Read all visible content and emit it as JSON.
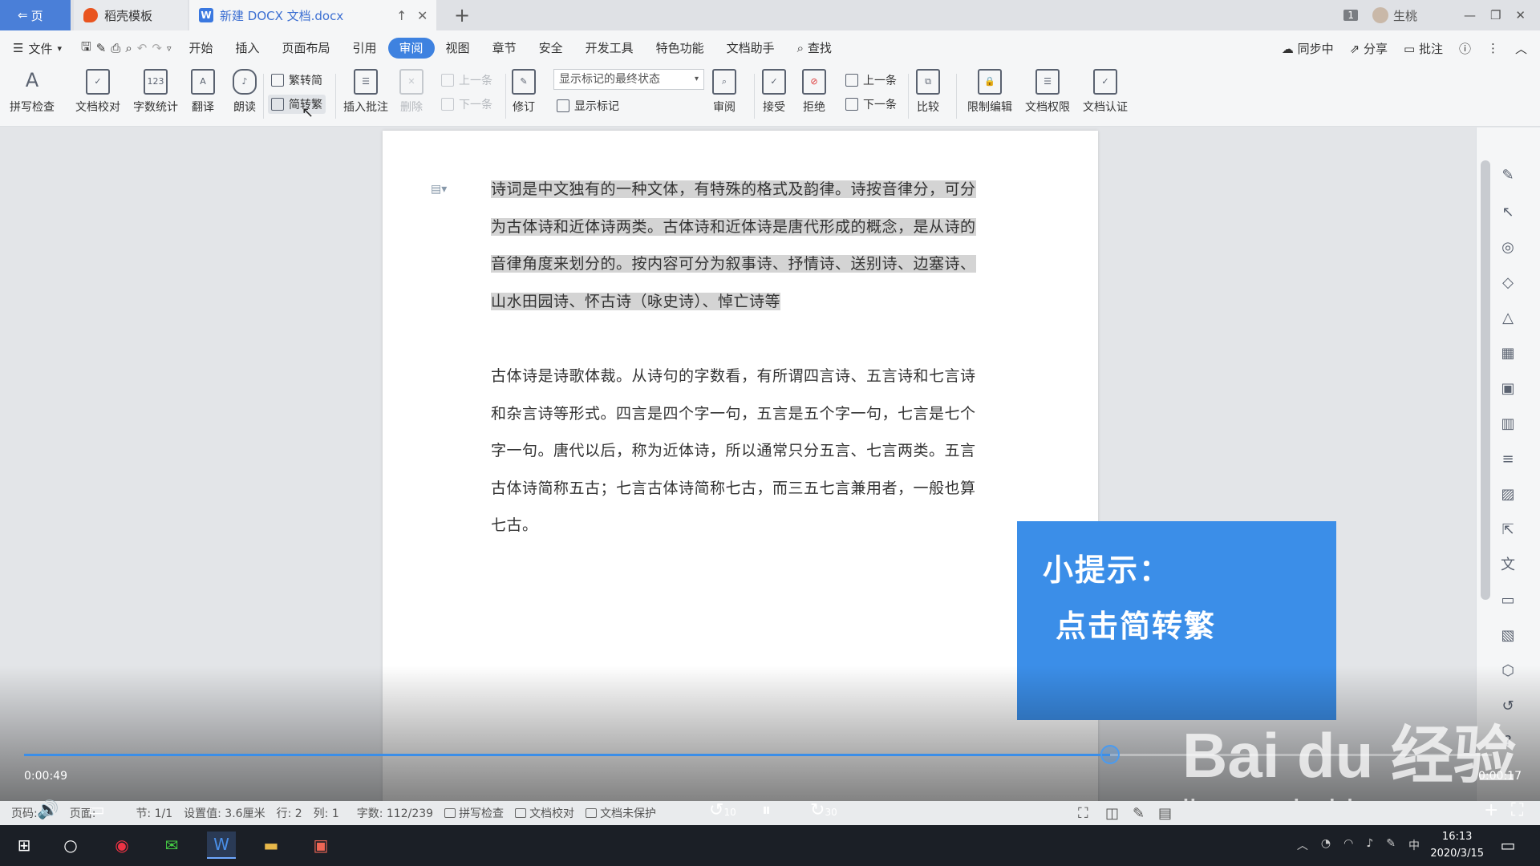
{
  "titlebar": {
    "home_tab": "页",
    "tab_daoke": "稻壳模板",
    "tab_doc": "新建 DOCX 文档.docx",
    "window_count": "1",
    "user_name": "生桃"
  },
  "menubar": {
    "file": "文件",
    "items": [
      "开始",
      "插入",
      "页面布局",
      "引用",
      "审阅",
      "视图",
      "章节",
      "安全",
      "开发工具",
      "特色功能",
      "文档助手"
    ],
    "active_item": "审阅",
    "search": "查找",
    "sync": "同步中",
    "share": "分享",
    "comment": "批注"
  },
  "ribbon": {
    "spell_check": "拼写检查",
    "doc_proof": "文档校对",
    "word_count": "字数统计",
    "translate": "翻译",
    "read_aloud": "朗读",
    "trad_to_simp": "繁转简",
    "simp_to_trad": "简转繁",
    "insert_comment": "插入批注",
    "delete": "删除",
    "prev": "上一条",
    "next": "下一条",
    "track_changes": "修订",
    "markup_select": "显示标记的最终状态",
    "show_markup": "显示标记",
    "review": "审阅",
    "accept": "接受",
    "reject": "拒绝",
    "prev2": "上一条",
    "next2": "下一条",
    "compare": "比较",
    "restrict_edit": "限制编辑",
    "doc_permission": "文档权限",
    "doc_cert": "文档认证"
  },
  "document": {
    "paragraph1": "诗词是中文独有的一种文体，有特殊的格式及韵律。诗按音律分，可分为古体诗和近体诗两类。古体诗和近体诗是唐代形成的概念，是从诗的音律角度来划分的。按内容可分为叙事诗、抒情诗、送别诗、边塞诗、山水田园诗、怀古诗（咏史诗）、悼亡诗等",
    "paragraph2": "古体诗是诗歌体裁。从诗句的字数看，有所谓四言诗、五言诗和七言诗和杂言诗等形式。四言是四个字一句，五言是五个字一句，七言是七个字一句。唐代以后，称为近体诗，所以通常只分五言、七言两类。五言古体诗简称五古；七言古体诗简称七古，而三五七言兼用者，一般也算七古。"
  },
  "tip": {
    "title": "小提示：",
    "text": "点击简转繁"
  },
  "player": {
    "elapsed": "0:00:49",
    "remaining": "0:00:17",
    "progress_fraction": 0.74,
    "rewind_label": "10",
    "forward_label": "30",
    "accent": "#3b8ee8"
  },
  "statusbar": {
    "page_label": "页码:",
    "page_label2": "页面:",
    "section": "节: 1/1",
    "setting": "设置值: 3.6厘米",
    "row": "行: 2",
    "col": "列: 1",
    "word_count": "字数: 112/239",
    "spell_check": "拼写检查",
    "doc_proof": "文档校对",
    "protection": "文档未保护"
  },
  "watermark": {
    "brand": "Bai du 经验",
    "url": "jingyan.baidu.com"
  },
  "taskbar": {
    "time": "16:13",
    "date": "2020/3/15",
    "ime": "中"
  }
}
